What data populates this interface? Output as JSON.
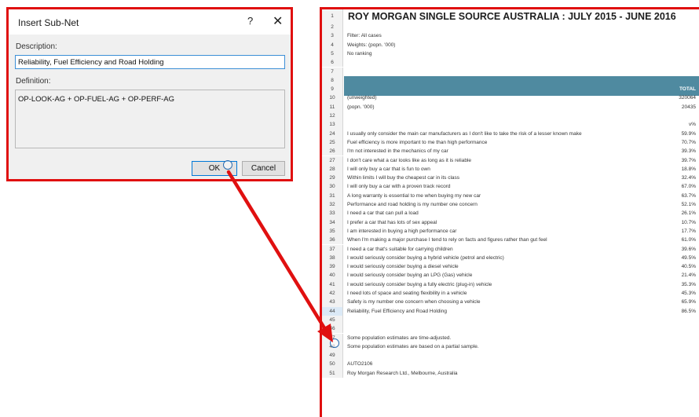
{
  "dialog": {
    "title": "Insert Sub-Net",
    "help_label": "?",
    "close_label": "✕",
    "description_label": "Description:",
    "description_value": "Reliability, Fuel Efficiency and Road Holding",
    "definition_label": "Definition:",
    "definition_value": "OP-LOOK-AG + OP-FUEL-AG + OP-PERF-AG",
    "ok_label": "OK",
    "cancel_label": "Cancel"
  },
  "sheet": {
    "title": "ROY MORGAN SINGLE SOURCE AUSTRALIA : JULY 2015 - JUNE 2016",
    "total_header": "TOTAL",
    "rows": [
      {
        "n": "2",
        "a": "",
        "b": ""
      },
      {
        "n": "3",
        "a": "Filter: All cases",
        "b": ""
      },
      {
        "n": "4",
        "a": "Weights: (popn. '000)",
        "b": ""
      },
      {
        "n": "5",
        "a": "No ranking",
        "b": ""
      },
      {
        "n": "6",
        "a": "",
        "b": ""
      },
      {
        "n": "7",
        "a": "",
        "b": ""
      },
      {
        "n": "8",
        "a": "",
        "b": ""
      },
      {
        "n": "9",
        "a": "",
        "b": ""
      },
      {
        "n": "10",
        "a": "(unweighted)",
        "b": "320064"
      },
      {
        "n": "11",
        "a": "(popn. '000)",
        "b": "20435"
      },
      {
        "n": "12",
        "a": "",
        "b": ""
      },
      {
        "n": "13",
        "a": "",
        "b": "v%"
      },
      {
        "n": "24",
        "a": "I usually only consider the main car manufacturers as I don't like to take the risk of a lesser known make",
        "b": "59.9%"
      },
      {
        "n": "25",
        "a": "Fuel efficiency is more important to me than high performance",
        "b": "70.7%"
      },
      {
        "n": "26",
        "a": "I'm not interested in the mechanics of my car",
        "b": "39.3%"
      },
      {
        "n": "27",
        "a": "I don't care what a car looks like as long as it is reliable",
        "b": "39.7%"
      },
      {
        "n": "28",
        "a": "I will only buy a car that is fun to own",
        "b": "18.8%"
      },
      {
        "n": "29",
        "a": "Within limits I will buy the cheapest car in its class",
        "b": "32.4%"
      },
      {
        "n": "30",
        "a": "I will only buy a car with a proven track record",
        "b": "67.0%"
      },
      {
        "n": "31",
        "a": "A long warranty is essential to me when buying my new car",
        "b": "63.7%"
      },
      {
        "n": "32",
        "a": "Performance and road holding is my number one concern",
        "b": "52.1%"
      },
      {
        "n": "33",
        "a": "I need a car that can pull a load",
        "b": "26.1%"
      },
      {
        "n": "34",
        "a": "I prefer a car that has lots of sex appeal",
        "b": "10.7%"
      },
      {
        "n": "35",
        "a": "I am interested in buying a high performance car",
        "b": "17.7%"
      },
      {
        "n": "36",
        "a": "When I'm making a major purchase I tend to rely on facts and figures rather than gut feel",
        "b": "61.0%"
      },
      {
        "n": "37",
        "a": "I need a car that's suitable for carrying children",
        "b": "39.6%"
      },
      {
        "n": "38",
        "a": "I would seriously consider buying a hybrid vehicle (petrol and electric)",
        "b": "49.5%"
      },
      {
        "n": "39",
        "a": "I would seriously consider buying a diesel vehicle",
        "b": "40.5%"
      },
      {
        "n": "40",
        "a": "I would seriously consider buying an LPG (Gas) vehicle",
        "b": "21.4%"
      },
      {
        "n": "41",
        "a": "I would seriously consider buying a fully electric (plug-in) vehicle",
        "b": "35.3%"
      },
      {
        "n": "42",
        "a": "I need lots of space and seating flexibility in a vehicle",
        "b": "45.3%"
      },
      {
        "n": "43",
        "a": "Safety is my number one concern when choosing a vehicle",
        "b": "65.9%"
      },
      {
        "n": "44",
        "a": "Reliability, Fuel Efficiency and Road Holding",
        "b": "86.5%"
      },
      {
        "n": "45",
        "a": "",
        "b": ""
      },
      {
        "n": "46",
        "a": "",
        "b": ""
      },
      {
        "n": "47",
        "a": "Some population estimates are time-adjusted.",
        "b": ""
      },
      {
        "n": "48",
        "a": "Some population estimates are based on a partial sample.",
        "b": ""
      },
      {
        "n": "49",
        "a": "",
        "b": ""
      },
      {
        "n": "50",
        "a": "AUTO2106",
        "b": ""
      },
      {
        "n": "51",
        "a": "Roy Morgan Research Ltd., Melbourne, Australia",
        "b": ""
      }
    ]
  }
}
